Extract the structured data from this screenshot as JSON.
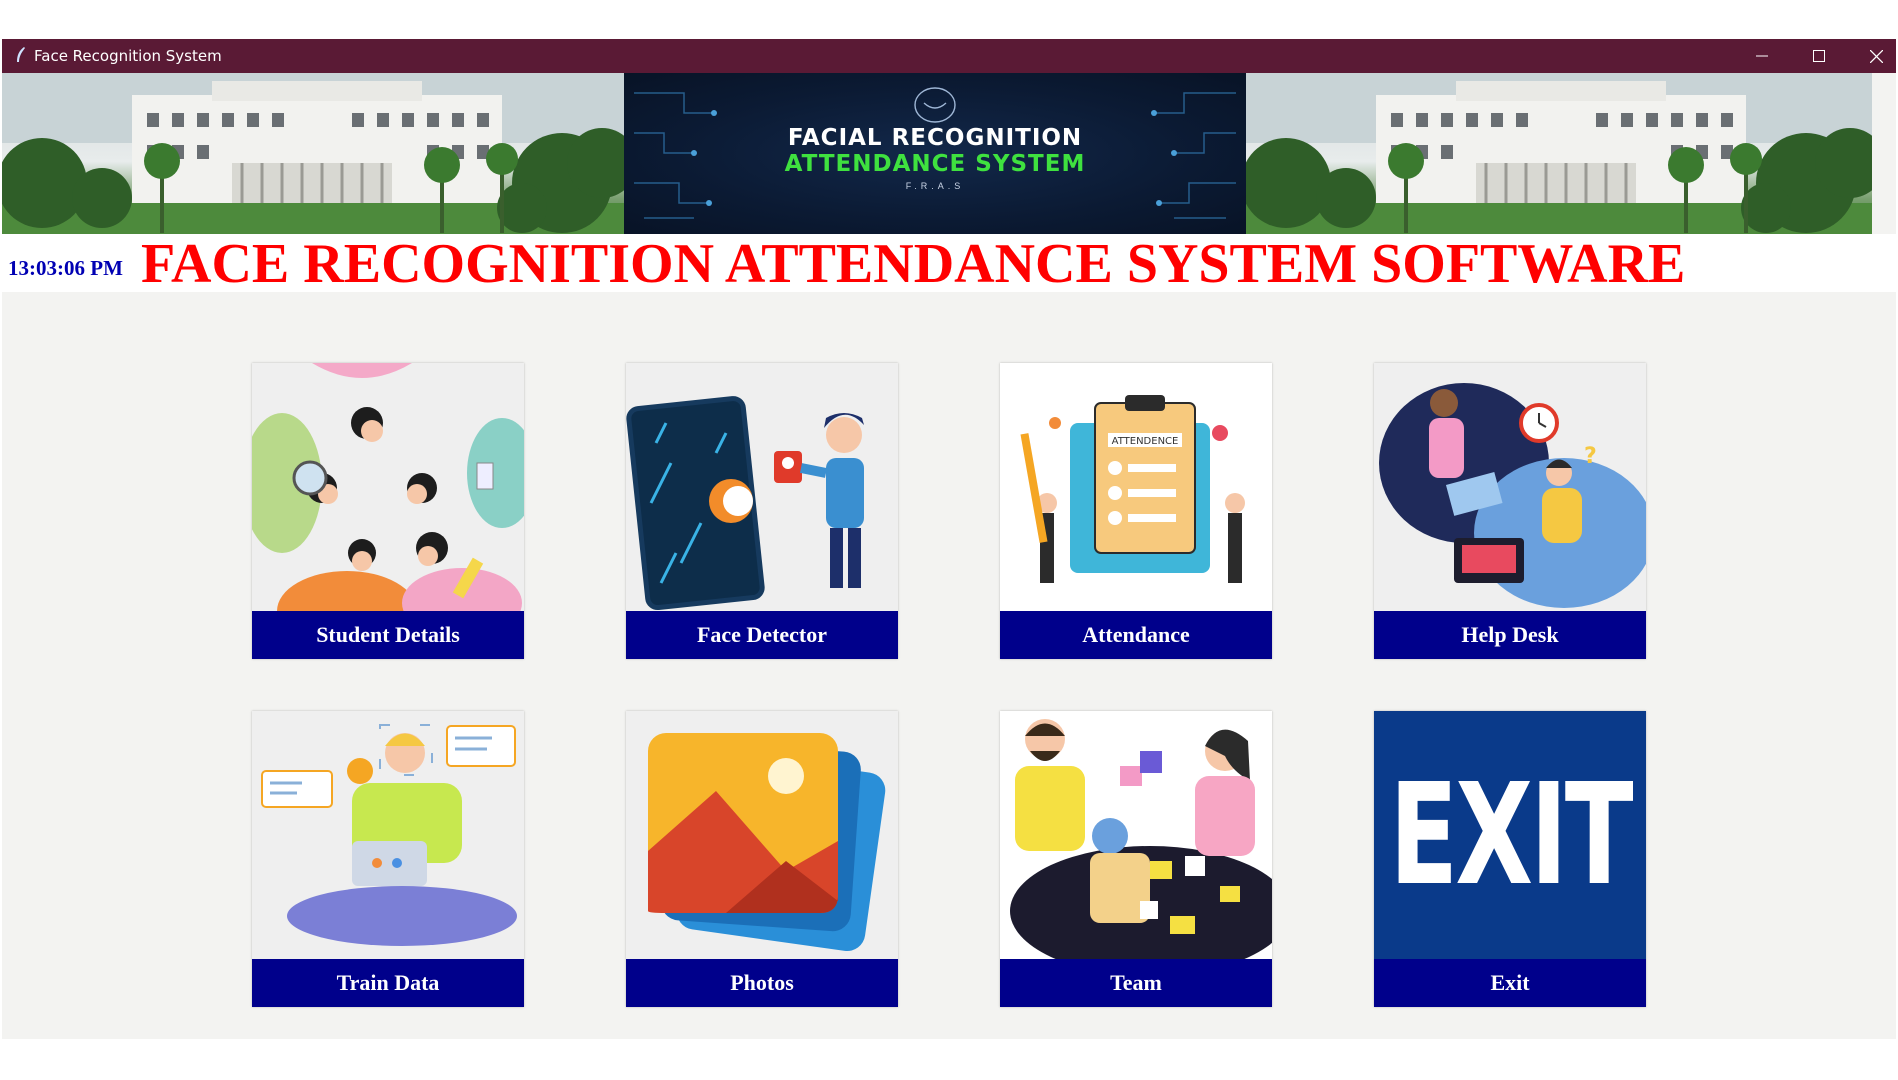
{
  "window": {
    "title": "Face Recognition System",
    "titlebar_color": "#5a1a35",
    "controls": [
      "minimize-icon",
      "maximize-icon",
      "close-icon"
    ]
  },
  "banner": {
    "line1": "FACIAL RECOGNITION",
    "line2": "ATTENDANCE SYSTEM",
    "line3": "F.R.A.S"
  },
  "header": {
    "clock": "13:03:06 PM",
    "title": "FACE RECOGNITION ATTENDANCE SYSTEM SOFTWARE",
    "title_color": "#ff0000",
    "clock_color": "#0000b3"
  },
  "tiles": [
    {
      "label": "Student Details",
      "icon": "students-illustration"
    },
    {
      "label": "Face Detector",
      "icon": "face-scan-illustration"
    },
    {
      "label": "Attendance",
      "icon": "attendance-clipboard-illustration"
    },
    {
      "label": "Help Desk",
      "icon": "help-desk-illustration"
    },
    {
      "label": "Train Data",
      "icon": "train-data-illustration"
    },
    {
      "label": "Photos",
      "icon": "photos-illustration"
    },
    {
      "label": "Team",
      "icon": "team-puzzle-illustration"
    },
    {
      "label": "Exit",
      "icon": "exit-sign"
    }
  ],
  "exit_sign_text": "EXIT",
  "tile_label_color": "#00008b"
}
